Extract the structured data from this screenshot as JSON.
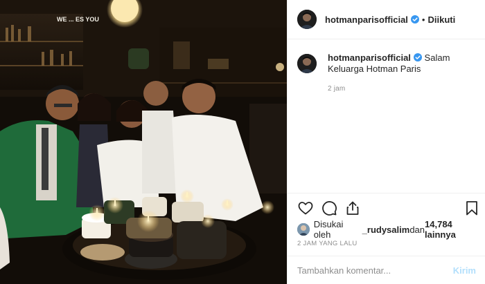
{
  "post": {
    "author": {
      "username": "hotmanparisofficial",
      "verified": true,
      "follow_state": "Diikuti",
      "separator": "•"
    },
    "photo": {
      "sign_text": "WE ... ES YOU"
    },
    "caption": {
      "username": "hotmanparisofficial",
      "text": "Salam Keluarga Hotman Paris",
      "time": "2 jam"
    },
    "actions": {
      "like_icon": "heart-icon",
      "comment_icon": "comment-icon",
      "share_icon": "share-icon",
      "save_icon": "bookmark-icon"
    },
    "likes": {
      "prefix": "Disukai oleh ",
      "user": "_rudysalim",
      "middle": " dan ",
      "count": "14,784 lainnya"
    },
    "date": "2 JAM YANG LALU",
    "comment_input": {
      "placeholder": "Tambahkan komentar...",
      "post_label": "Kirim"
    },
    "colors": {
      "verified_blue": "#3897f0",
      "muted_text": "#8e8e8e",
      "post_button_disabled": "#b2dffc",
      "border": "#efefef"
    }
  }
}
